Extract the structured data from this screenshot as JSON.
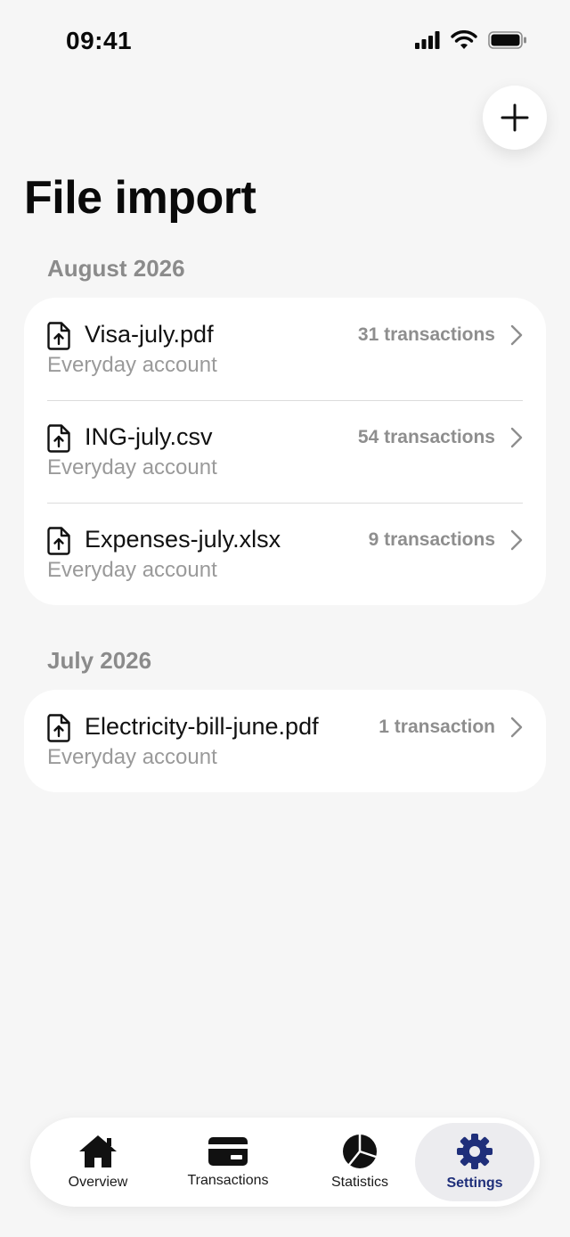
{
  "status_bar": {
    "time": "09:41"
  },
  "header": {
    "title": "File import",
    "add_button_icon": "plus-icon"
  },
  "sections": [
    {
      "title": "August 2026",
      "items": [
        {
          "file_name": "Visa-july.pdf",
          "account": "Everyday account",
          "count": "31 transactions"
        },
        {
          "file_name": "ING-july.csv",
          "account": "Everyday account",
          "count": "54 transactions"
        },
        {
          "file_name": "Expenses-july.xlsx",
          "account": "Everyday account",
          "count": "9 transactions"
        }
      ]
    },
    {
      "title": "July 2026",
      "items": [
        {
          "file_name": "Electricity-bill-june.pdf",
          "account": "Everyday account",
          "count": "1 transaction"
        }
      ]
    }
  ],
  "tabbar": {
    "tabs": [
      {
        "label": "Overview",
        "icon": "home-icon"
      },
      {
        "label": "Transactions",
        "icon": "card-icon"
      },
      {
        "label": "Statistics",
        "icon": "pie-chart-icon"
      },
      {
        "label": "Settings",
        "icon": "gear-icon"
      }
    ],
    "active_color": "#1f2f7a"
  }
}
